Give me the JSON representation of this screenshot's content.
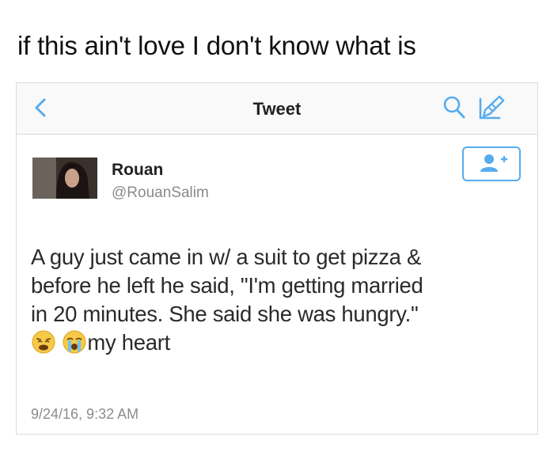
{
  "caption": "if this ain't love I don't know what is",
  "colors": {
    "accent": "#55acee",
    "handle": "#8a8a8a"
  },
  "nav": {
    "back_icon": "chevron-left-icon",
    "title": "Tweet",
    "search_icon": "search-icon",
    "compose_icon": "compose-icon"
  },
  "user": {
    "name": "Rouan",
    "handle": "@RouanSalim",
    "follow_icon": "add-user-icon"
  },
  "tweet": {
    "lines": [
      "A guy just came in w/ a suit to get pizza &",
      "before he left he said, \"I'm getting married",
      "in 20 minutes. She said she was hungry.\""
    ],
    "emojis": [
      "weary-face-icon",
      "loudly-crying-face-icon"
    ],
    "last_line": "my heart",
    "timestamp": "9/24/16, 9:32 AM"
  }
}
